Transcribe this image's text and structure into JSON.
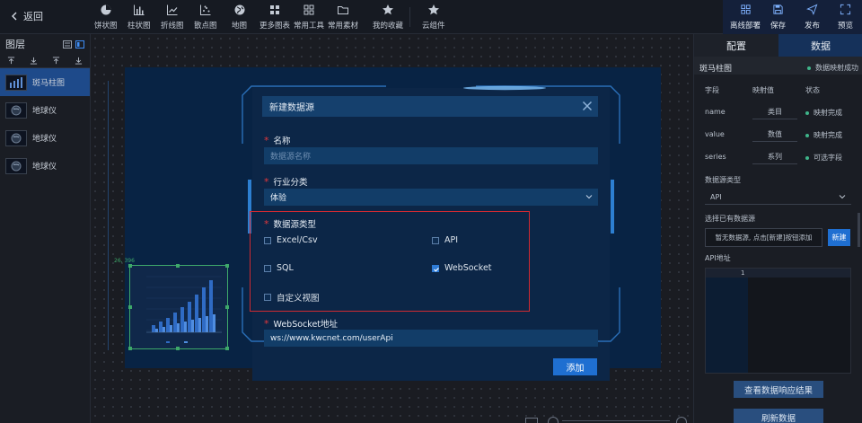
{
  "header": {
    "back_label": "返回",
    "tools": [
      {
        "label": "饼状图",
        "icon": "pie-chart-icon"
      },
      {
        "label": "柱状图",
        "icon": "bar-chart-icon"
      },
      {
        "label": "折线图",
        "icon": "line-chart-icon"
      },
      {
        "label": "散点图",
        "icon": "scatter-chart-icon"
      },
      {
        "label": "地图",
        "icon": "globe-icon"
      },
      {
        "label": "更多图表",
        "icon": "more-charts-icon"
      },
      {
        "label": "常用工具",
        "icon": "grid-tools-icon"
      },
      {
        "label": "常用素材",
        "icon": "folder-icon"
      },
      {
        "label": "我的收藏",
        "icon": "star-icon"
      },
      {
        "label": "云组件",
        "icon": "star-icon"
      }
    ],
    "actions": [
      {
        "label": "离线部署",
        "icon": "grid-icon"
      },
      {
        "label": "保存",
        "icon": "save-icon"
      },
      {
        "label": "发布",
        "icon": "send-icon"
      },
      {
        "label": "预览",
        "icon": "expand-icon"
      }
    ]
  },
  "layers": {
    "title": "图层",
    "items": [
      {
        "label": "斑马柱图",
        "active": true
      },
      {
        "label": "地球仪"
      },
      {
        "label": "地球仪"
      },
      {
        "label": "地球仪"
      }
    ]
  },
  "canvas": {
    "selection_label": "26, 396"
  },
  "modal": {
    "title": "新建数据源",
    "name_label": "名称",
    "name_placeholder": "数据源名称",
    "industry_label": "行业分类",
    "industry_value": "体验",
    "type_label": "数据源类型",
    "options": [
      {
        "label": "Excel/Csv",
        "checked": false
      },
      {
        "label": "API",
        "checked": false
      },
      {
        "label": "SQL",
        "checked": false
      },
      {
        "label": "WebSocket",
        "checked": true
      },
      {
        "label": "自定义视图",
        "checked": false
      }
    ],
    "ws_label": "WebSocket地址",
    "ws_value": "ws://www.kwcnet.com/userApi",
    "add_button": "添加"
  },
  "rpanel": {
    "tab_config": "配置",
    "tab_data": "数据",
    "component_name": "斑马柱图",
    "map_status": "数据映射成功",
    "col_field": "字段",
    "col_map": "映射值",
    "col_status": "状态",
    "rows": [
      {
        "field": "name",
        "value": "类目",
        "status": "映射完成"
      },
      {
        "field": "value",
        "value": "数值",
        "status": "映射完成"
      },
      {
        "field": "series",
        "value": "系列",
        "status": "可选字段"
      }
    ],
    "ds_type_label": "数据源类型",
    "ds_type_value": "API",
    "existing_label": "选择已有数据源",
    "existing_text": "暂无数据源, 点击[新建]按钮添加",
    "new_button": "新建",
    "api_label": "API地址",
    "line_number": "1",
    "view_result_button": "查看数据响应结果",
    "refresh_button": "刷新数据"
  },
  "colors": {
    "accent": "#1f6fd1",
    "panel_bg": "#1a1d24",
    "modal_bg": "#0c2647",
    "required": "#e2373c",
    "highlight": "#d02a32",
    "success": "#3fb58a"
  }
}
